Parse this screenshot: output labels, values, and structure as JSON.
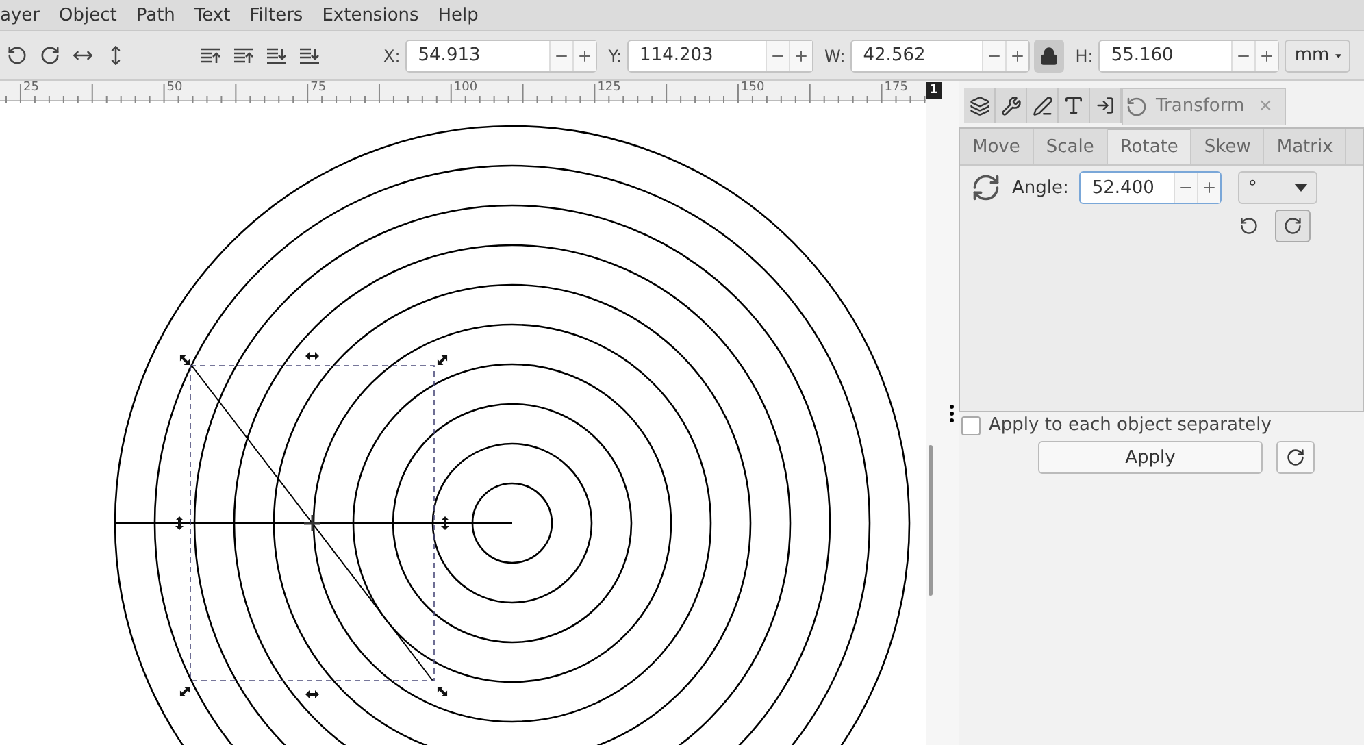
{
  "menu": [
    "ayer",
    "Object",
    "Path",
    "Text",
    "Filters",
    "Extensions",
    "Help"
  ],
  "toolbar": {
    "fields": [
      {
        "label": "X:",
        "value": "54.913"
      },
      {
        "label": "Y:",
        "value": "114.203"
      },
      {
        "label": "W:",
        "value": "42.562"
      },
      {
        "label": "H:",
        "value": "55.160"
      }
    ],
    "lock": {
      "on": true
    },
    "unit": "mm"
  },
  "ruler": {
    "labels": [
      "25",
      "50",
      "75",
      "100",
      "125",
      "150",
      "175"
    ],
    "page_badge": "1"
  },
  "dock": {
    "tab_label": "Transform",
    "close": "×"
  },
  "tabs": [
    {
      "label": "Move",
      "selected": false
    },
    {
      "label": "Scale",
      "selected": false
    },
    {
      "label": "Rotate",
      "selected": true
    },
    {
      "label": "Skew",
      "selected": false
    },
    {
      "label": "Matrix",
      "selected": false
    }
  ],
  "rotate": {
    "label": "Angle:",
    "value": "52.400",
    "unit": "°",
    "directions": [
      {
        "kind": "ccw",
        "selected": false
      },
      {
        "kind": "cw",
        "selected": true
      }
    ]
  },
  "apply_separately": {
    "label": "Apply to each object separately",
    "checked": false
  },
  "apply_button": "Apply"
}
